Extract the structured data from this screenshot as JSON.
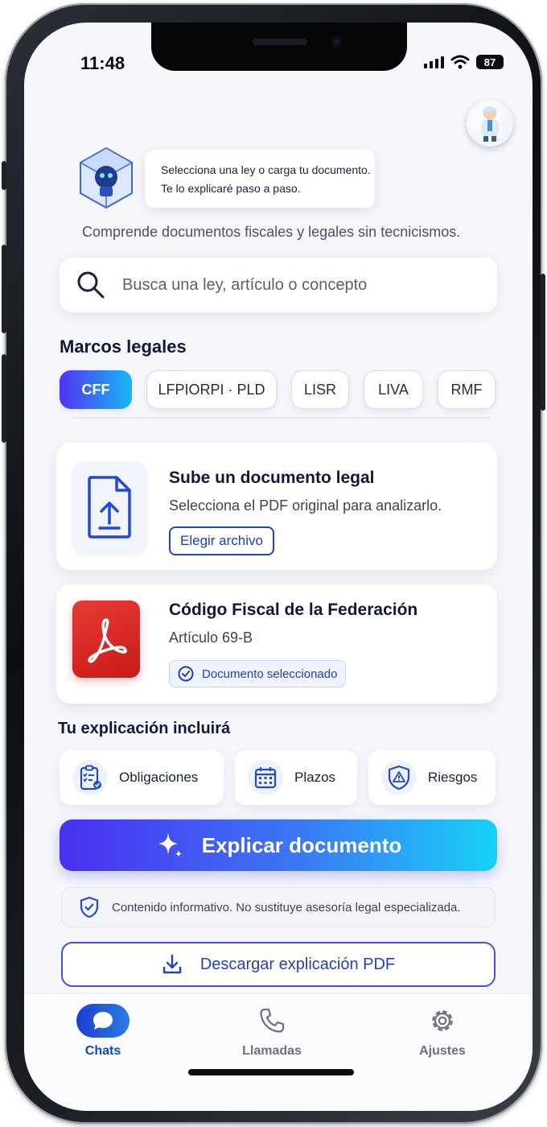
{
  "status_bar": {
    "time": "11:48",
    "battery": "87"
  },
  "assistant": {
    "bubble_line1": "Selecciona una ley o carga tu documento.",
    "bubble_line2": "Te lo explicaré paso a paso."
  },
  "subtitle": "Comprende documentos fiscales y legales sin tecnicismos.",
  "search": {
    "placeholder": "Busca una ley, artículo o concepto"
  },
  "legal_frameworks": {
    "title": "Marcos legales",
    "chips": [
      "CFF",
      "LFPIORPI · PLD",
      "LISR",
      "LIVA",
      "RMF"
    ],
    "active": "CFF"
  },
  "upload_card": {
    "title": "Sube un documento legal",
    "subtitle": "Selecciona el PDF original para analizarlo.",
    "button": "Elegir archivo"
  },
  "document_card": {
    "title": "Código Fiscal de la Federación",
    "article": "Artículo 69-B",
    "badge": "Documento seleccionado"
  },
  "explanation": {
    "title": "Tu explicación incluirá",
    "features": [
      {
        "label": "Obligaciones",
        "icon": "checklist-icon"
      },
      {
        "label": "Plazos",
        "icon": "calendar-icon"
      },
      {
        "label": "Riesgos",
        "icon": "warning-shield-icon"
      }
    ]
  },
  "primary_action": "Explicar documento",
  "disclaimer": "Contenido informativo. No sustituye asesoría legal especializada.",
  "download_action": "Descargar explicación PDF",
  "tabbar": {
    "tabs": [
      {
        "label": "Chats",
        "icon": "chat-bubble-icon",
        "active": true
      },
      {
        "label": "Llamadas",
        "icon": "phone-icon",
        "active": false
      },
      {
        "label": "Ajustes",
        "icon": "gear-icon",
        "active": false
      }
    ]
  },
  "colors": {
    "accent": "#1f3cbf",
    "gradient_start": "#4a2ff0",
    "gradient_end": "#17d2f6",
    "pdf_red": "#d82a27"
  }
}
